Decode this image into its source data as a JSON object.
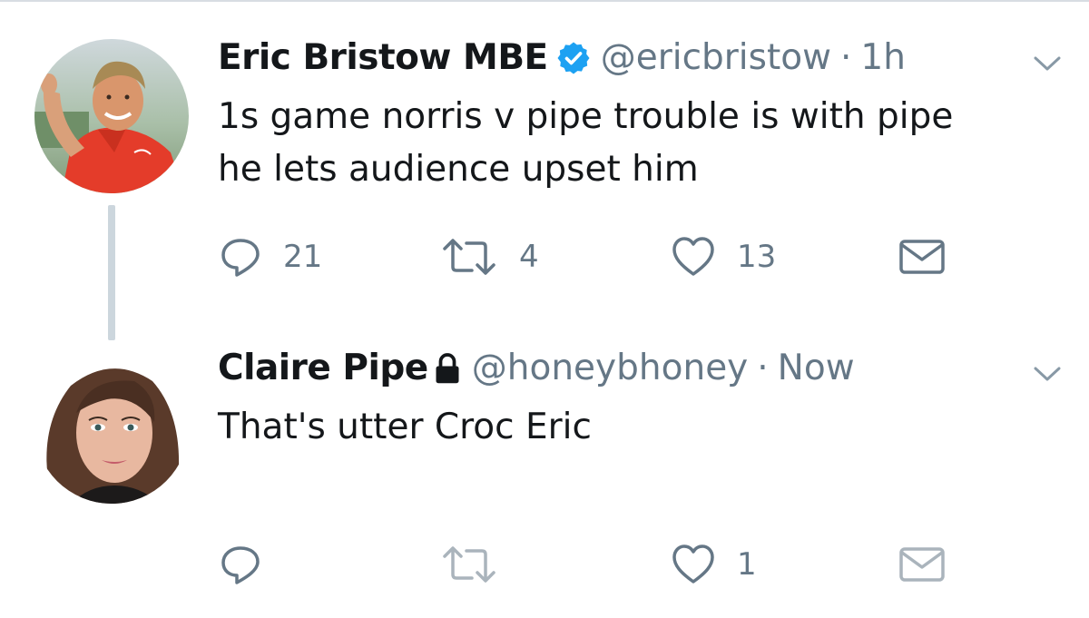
{
  "colors": {
    "text": "#14171a",
    "secondary": "#657786",
    "verified_blue": "#1da1f2",
    "thread_line": "#ccd6dd"
  },
  "tweets": [
    {
      "name": "Eric Bristow MBE",
      "badge": "verified-badge-icon",
      "handle": "@ericbristow",
      "separator": "·",
      "time": "1h",
      "text": "1s game norris v pipe trouble is with pipe\nhe lets audience upset him",
      "actions": {
        "reply_count": "21",
        "retweet_count": "4",
        "like_count": "13"
      }
    },
    {
      "name": "Claire Pipe",
      "badge": "lock-icon",
      "handle": "@honeybhoney",
      "separator": "·",
      "time": "Now",
      "text": "That's utter Croc Eric",
      "actions": {
        "reply_count": "",
        "retweet_count": "",
        "like_count": "1"
      }
    }
  ]
}
